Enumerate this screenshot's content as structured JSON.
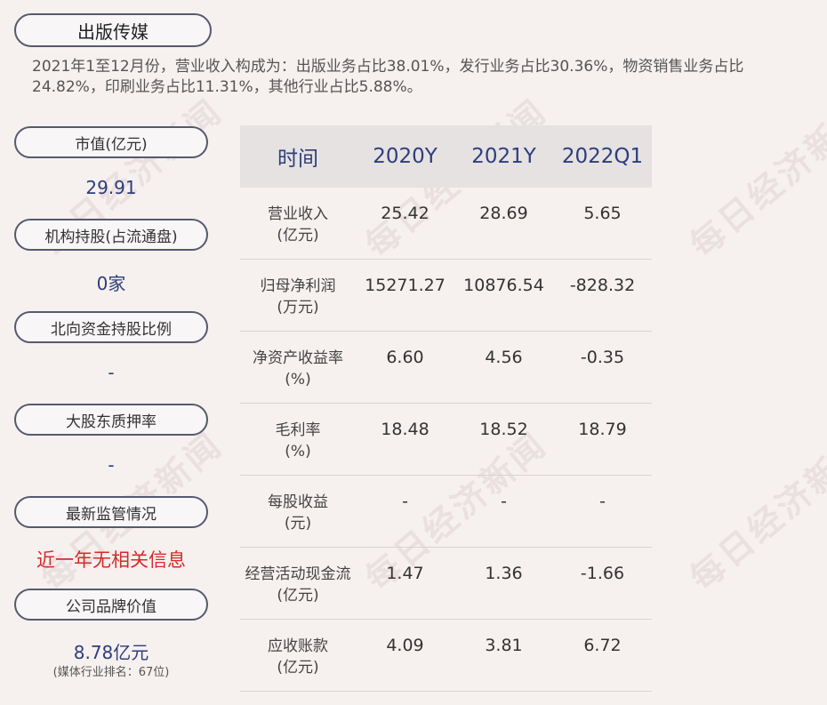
{
  "header": {
    "title": "出版传媒",
    "summary": "2021年1至12月份，营业收入构成为：出版业务占比38.01%，发行业务占比30.36%，物资销售业务占比24.82%，印刷业务占比11.31%，其他行业占比5.88%。"
  },
  "watermark": "每日经济新闻",
  "left": [
    {
      "label": "市值(亿元)",
      "value": "29.91"
    },
    {
      "label": "机构持股(占流通盘)",
      "value": "0家"
    },
    {
      "label": "北向资金持股比例",
      "value": "-"
    },
    {
      "label": "大股东质押率",
      "value": "-"
    },
    {
      "label": "最新监管情况",
      "value": "近一年无相关信息"
    },
    {
      "label": "公司品牌价值",
      "value": "8.78亿元",
      "sub": "(媒体行业排名：67位)"
    }
  ],
  "table": {
    "columns": [
      "时间",
      "2020Y",
      "2021Y",
      "2022Q1"
    ],
    "rows": [
      {
        "name": "营业收入",
        "unit": "(亿元)",
        "values": [
          "25.42",
          "28.69",
          "5.65"
        ]
      },
      {
        "name": "归母净利润",
        "unit": "(万元)",
        "values": [
          "15271.27",
          "10876.54",
          "-828.32"
        ]
      },
      {
        "name": "净资产收益率",
        "unit": "(%)",
        "values": [
          "6.60",
          "4.56",
          "-0.35"
        ]
      },
      {
        "name": "毛利率",
        "unit": "(%)",
        "values": [
          "18.48",
          "18.52",
          "18.79"
        ]
      },
      {
        "name": "每股收益",
        "unit": "(元)",
        "values": [
          "-",
          "-",
          "-"
        ]
      },
      {
        "name": "经营活动现金流",
        "unit": "(亿元)",
        "values": [
          "1.47",
          "1.36",
          "-1.66"
        ]
      },
      {
        "name": "应收账款",
        "unit": "(亿元)",
        "values": [
          "4.09",
          "3.81",
          "6.72"
        ]
      }
    ]
  },
  "colors": {
    "background": "#f6f0ef",
    "accent_blue": "#2d3e7a",
    "alert_red": "#d62a2a",
    "pill_border": "#555a6e",
    "header_bg": "#e6e2e2"
  }
}
